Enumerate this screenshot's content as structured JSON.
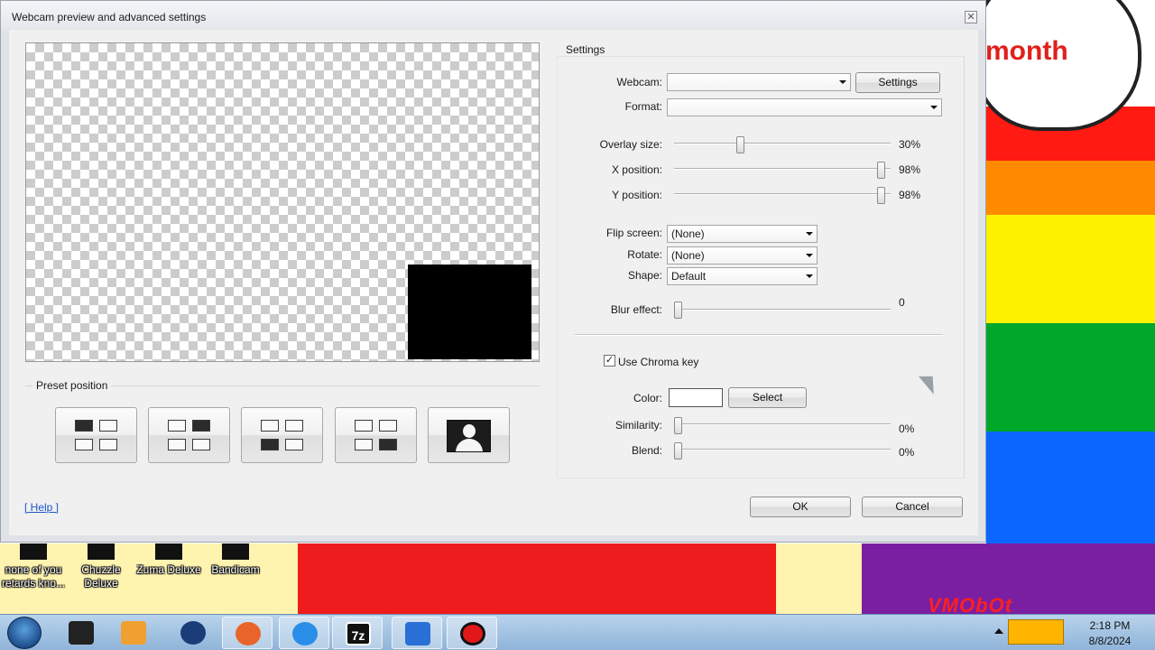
{
  "desktop": {
    "cloud_text": "month",
    "graffiti_text": "VMObOt",
    "icons": [
      {
        "label": "none of you retards kno...",
        "name": "desktop-icon-none-of-you"
      },
      {
        "label": "Chuzzle Deluxe",
        "name": "desktop-icon-chuzzle"
      },
      {
        "label": "Zuma Deluxe",
        "name": "desktop-icon-zuma"
      },
      {
        "label": "Bandicam",
        "name": "desktop-icon-bandicam"
      }
    ]
  },
  "dialog": {
    "title": "Webcam preview and advanced settings",
    "close_glyph": "✕",
    "preset_position_label": "Preset position",
    "settings_label": "Settings",
    "help_label": "[ Help ]",
    "ok_label": "OK",
    "cancel_label": "Cancel"
  },
  "settings": {
    "webcam_label": "Webcam:",
    "webcam_value": "",
    "settings_button": "Settings",
    "format_label": "Format:",
    "format_value": "",
    "overlay_size_label": "Overlay size:",
    "overlay_size_value": "30%",
    "overlay_size_level": 0.3,
    "x_position_label": "X position:",
    "x_position_value": "98%",
    "x_position_level": 0.98,
    "y_position_label": "Y position:",
    "y_position_value": "98%",
    "y_position_level": 0.98,
    "flip_screen_label": "Flip screen:",
    "flip_screen_value": "(None)",
    "rotate_label": "Rotate:",
    "rotate_value": "(None)",
    "shape_label": "Shape:",
    "shape_value": "Default",
    "blur_label": "Blur effect:",
    "blur_value": "0",
    "blur_level": 0,
    "chroma_label": "Use Chroma key",
    "chroma_checked": true,
    "check_glyph": "✓",
    "color_label": "Color:",
    "color_value": "#ffffff",
    "select_button": "Select",
    "similarity_label": "Similarity:",
    "similarity_value": "0%",
    "similarity_level": 0,
    "blend_label": "Blend:",
    "blend_value": "0%",
    "blend_level": 0
  },
  "presets": [
    {
      "name": "preset-top-left-button",
      "active_cell": 1
    },
    {
      "name": "preset-top-right-button",
      "active_cell": 2
    },
    {
      "name": "preset-bottom-left-button",
      "active_cell": 3
    },
    {
      "name": "preset-bottom-right-button",
      "active_cell": 4
    },
    {
      "name": "preset-fullscreen-button",
      "active_cell": 0
    }
  ],
  "taskbar": {
    "apps": [
      {
        "name": "taskbar-app-dark",
        "color": "#222222"
      },
      {
        "name": "taskbar-app-media",
        "color": "#f0a030"
      },
      {
        "name": "taskbar-app-globe",
        "color": "#1a3d7a"
      },
      {
        "name": "taskbar-app-firefox",
        "color": "#e8642a"
      },
      {
        "name": "taskbar-app-ie",
        "color": "#2a8ee8"
      },
      {
        "name": "taskbar-app-7zip",
        "color": "#111111",
        "text": "7z"
      },
      {
        "name": "taskbar-app-player",
        "color": "#2a6fd6"
      },
      {
        "name": "taskbar-app-bandicam",
        "color": "#e01818"
      }
    ],
    "time": "2:18 PM",
    "date": "8/8/2024"
  },
  "colors": {
    "accent_link": "#1a57c9",
    "overlay_box": "#000000"
  }
}
